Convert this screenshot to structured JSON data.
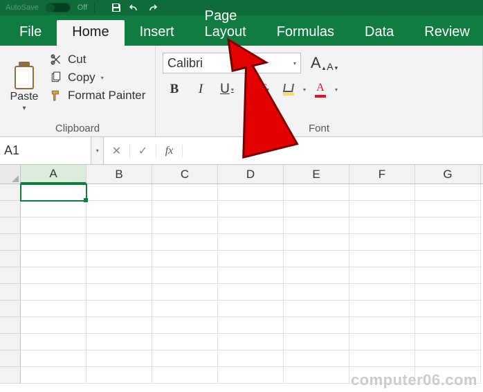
{
  "titlebar": {
    "autosave_label": "AutoSave",
    "autosave_state": "Off"
  },
  "tabs": {
    "file": "File",
    "home": "Home",
    "insert": "Insert",
    "page_layout": "Page Layout",
    "formulas": "Formulas",
    "data": "Data",
    "review": "Review",
    "active": "home"
  },
  "clipboard": {
    "paste_label": "Paste",
    "cut_label": "Cut",
    "copy_label": "Copy",
    "format_painter_label": "Format Painter",
    "group_label": "Clipboard"
  },
  "font": {
    "name_value": "Calibri",
    "group_label": "Font",
    "bold": "B",
    "italic": "I",
    "underline": "U",
    "grow": "A",
    "shrink": "A",
    "font_color_glyph": "A"
  },
  "namebox": {
    "value": "A1"
  },
  "formula_bar": {
    "fx_label": "fx",
    "value": ""
  },
  "columns": [
    "A",
    "B",
    "C",
    "D",
    "E",
    "F",
    "G"
  ],
  "selected_cell": "A1",
  "watermark": "computer06.com",
  "arrow_target_tab": "Page Layout",
  "chart_data": null
}
